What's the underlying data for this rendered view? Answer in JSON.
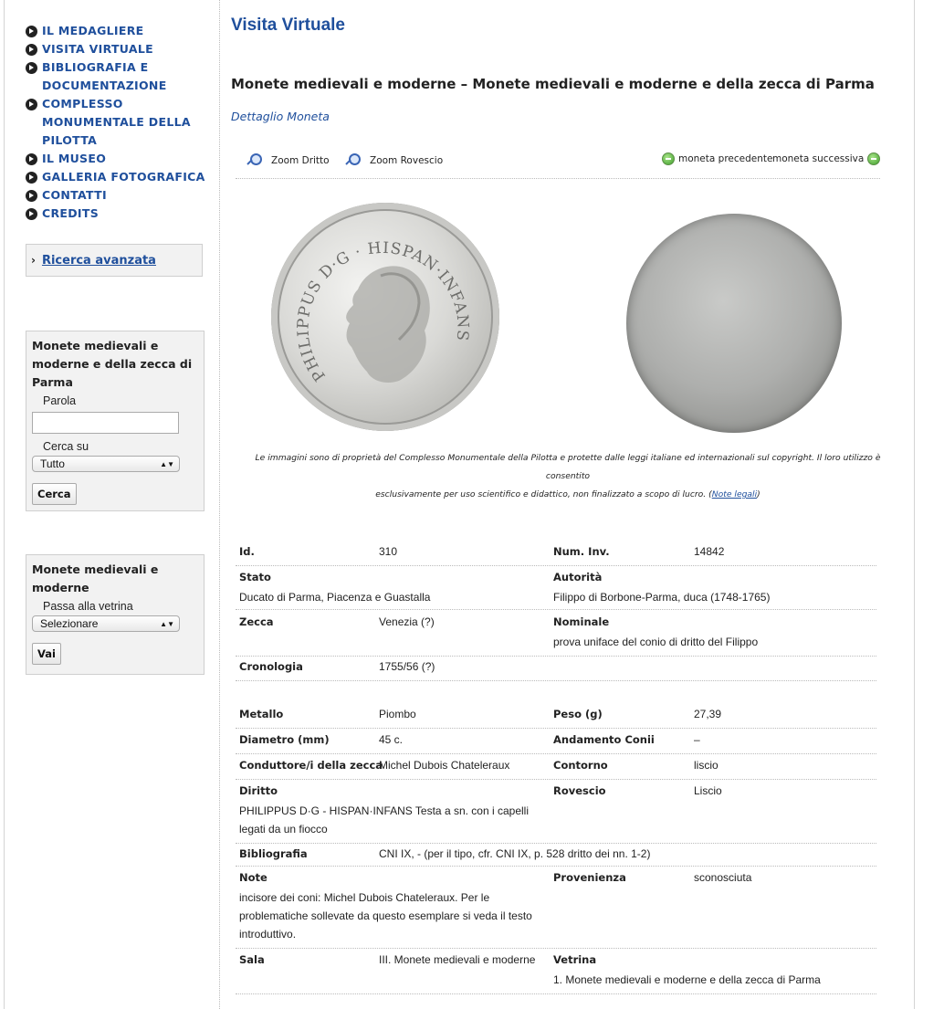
{
  "sidebar": {
    "menu": [
      "IL MEDAGLIERE",
      "VISITA VIRTUALE",
      "BIBLIOGRAFIA E DOCUMENTAZIONE",
      "COMPLESSO MONUMENTALE DELLA PILOTTA",
      "IL MUSEO",
      "GALLERIA FOTOGRAFICA",
      "CONTATTI",
      "CREDITS"
    ],
    "advanced_search": "Ricerca avanzata",
    "search_form": {
      "title": "Monete medievali e moderne e della zecca di Parma",
      "word_label": "Parola",
      "word_value": "",
      "search_in_label": "Cerca su",
      "search_in_value": "Tutto",
      "button": "Cerca"
    },
    "showcase_form": {
      "title": "Monete medievali e moderne",
      "label": "Passa alla vetrina",
      "value": "Selezionare",
      "button": "Vai"
    }
  },
  "main": {
    "page_title": "Visita Virtuale",
    "coin_title": "Monete medievali e moderne – Monete medievali e moderne e della zecca di Parma",
    "detail_link": "Dettaglio Moneta",
    "toolbar": {
      "zoom_front": "Zoom Dritto",
      "zoom_back": "Zoom Rovescio",
      "prev": "moneta precedente",
      "next": "moneta successiva"
    },
    "images": {
      "obverse_legend": "PHILIPPUS D·G · HISPAN·INFANS"
    },
    "copyright_line1": "Le immagini sono di proprietà del Complesso Monumentale della Pilotta e protette dalle leggi italiane ed internazionali sul copyright. Il loro utilizzo è consentito",
    "copyright_line2": "esclusivamente per uso scientifico e didattico, non finalizzato a scopo di lucro. (",
    "copyright_link": "Note legali",
    "copyright_end": ")",
    "details": {
      "id_label": "Id.",
      "id_value": "310",
      "inv_label": "Num. Inv.",
      "inv_value": "14842",
      "stato_label": "Stato",
      "stato_value": "Ducato di Parma, Piacenza e Guastalla",
      "autorita_label": "Autorità",
      "autorita_value": "Filippo di Borbone-Parma, duca (1748-1765)",
      "zecca_label": "Zecca",
      "zecca_value": "Venezia (?)",
      "nominale_label": "Nominale",
      "nominale_value": "prova uniface del conio di dritto del Filippo",
      "cronologia_label": "Cronologia",
      "cronologia_value": "1755/56 (?)",
      "metallo_label": "Metallo",
      "metallo_value": "Piombo",
      "peso_label": "Peso (g)",
      "peso_value": "27,39",
      "diametro_label": "Diametro (mm)",
      "diametro_value": "45 c.",
      "andamento_label": "Andamento Conii",
      "andamento_value": "–",
      "conduttore_label": "Conduttore/i della zecca",
      "conduttore_value": "Michel Dubois Chateleraux",
      "contorno_label": "Contorno",
      "contorno_value": "liscio",
      "diritto_label": "Diritto",
      "diritto_value_1": "PHILIPPUS D·G - HISPAN·INFANS Testa a sn. con i capelli",
      "diritto_value_2": "legati da un fiocco",
      "rovescio_label": "Rovescio",
      "rovescio_value": "Liscio",
      "bibliografia_label": "Bibliografia",
      "bibliografia_value": "CNI IX, - (per il tipo, cfr. CNI IX, p. 528 dritto dei nn. 1-2)",
      "note_label": "Note",
      "note_value_1": "incisore dei coni: Michel Dubois Chateleraux. Per le",
      "note_value_2": "problematiche sollevate da questo esemplare si veda il testo",
      "note_value_3": "introduttivo.",
      "provenienza_label": "Provenienza",
      "provenienza_value": "sconosciuta",
      "sala_label": "Sala",
      "sala_value": "III. Monete medievali e moderne",
      "vetrina_label": "Vetrina",
      "vetrina_value": "1. Monete medievali e moderne e della zecca di Parma"
    }
  }
}
